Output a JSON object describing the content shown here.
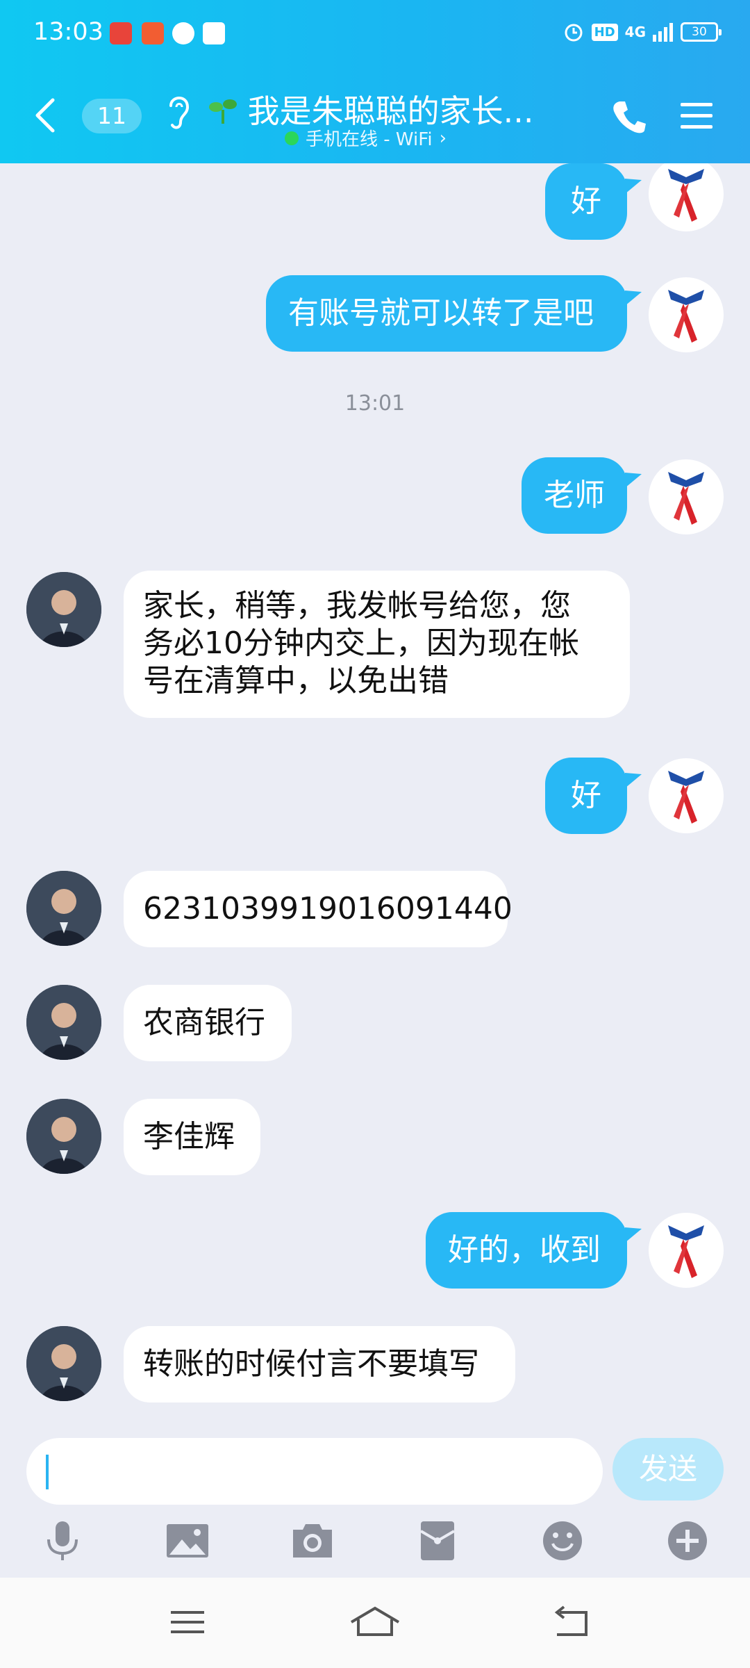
{
  "status": {
    "time": "13:03",
    "network": "4G",
    "hd": "HD",
    "battery": "30"
  },
  "header": {
    "unread_count": "11",
    "title": "我是朱聪聪的家长...",
    "subtitle": "手机在线 - WiFi",
    "accent": "#1ab6f2"
  },
  "messages": [
    {
      "side": "me",
      "text": "好"
    },
    {
      "side": "me",
      "text": "有账号就可以转了是吧"
    },
    {
      "timestamp": "13:01"
    },
    {
      "side": "me",
      "text": "老师"
    },
    {
      "side": "other",
      "lines": [
        "家长，稍等，我发帐号给您，您",
        "务必10分钟内交上，因为现在帐",
        "号在清算中，以免出错"
      ]
    },
    {
      "side": "me",
      "text": "好"
    },
    {
      "side": "other",
      "text": "6231039919016091440"
    },
    {
      "side": "other",
      "text": "农商银行"
    },
    {
      "side": "other",
      "text": "李佳辉"
    },
    {
      "side": "me",
      "text": "好的，收到"
    },
    {
      "side": "other",
      "text": "转账的时候付言不要填写"
    }
  ],
  "composer": {
    "placeholder": "",
    "send_label": "发送"
  },
  "toolbar": [
    "microphone-icon",
    "image-icon",
    "camera-icon",
    "red-packet-icon",
    "emoji-icon",
    "plus-icon"
  ],
  "nav": [
    "menu-icon",
    "home-icon",
    "back-icon"
  ]
}
